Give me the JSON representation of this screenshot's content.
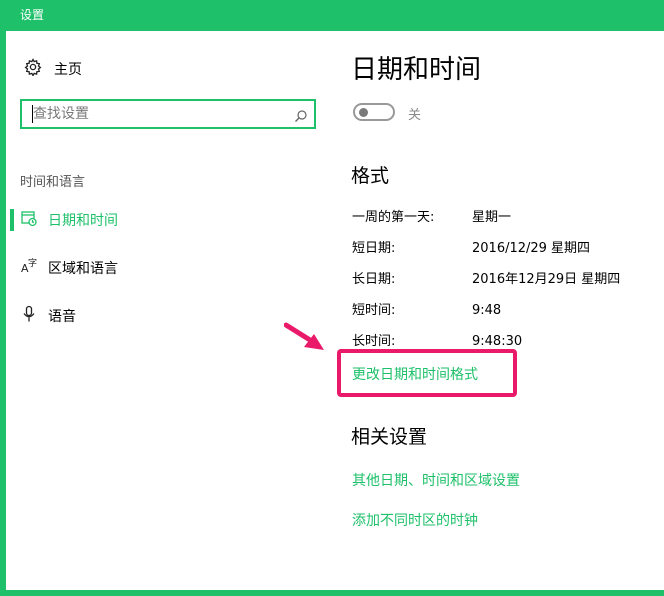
{
  "window": {
    "title": "设置"
  },
  "sidebar": {
    "home_label": "主页",
    "search": {
      "placeholder": "查找设置"
    },
    "section_label": "时间和语言",
    "items": [
      {
        "label": "日期和时间",
        "icon": "calendar-clock-icon",
        "active": true
      },
      {
        "label": "区域和语言",
        "icon": "language-icon",
        "active": false
      },
      {
        "label": "语音",
        "icon": "microphone-icon",
        "active": false
      }
    ]
  },
  "main": {
    "title": "日期和时间",
    "toggle": {
      "state_label": "关",
      "on": false
    },
    "format": {
      "heading": "格式",
      "rows": [
        {
          "label": "一周的第一天:",
          "value": "星期一"
        },
        {
          "label": "短日期:",
          "value": "2016/12/29 星期四"
        },
        {
          "label": "长日期:",
          "value": "2016年12月29日 星期四"
        },
        {
          "label": "短时间:",
          "value": "9:48"
        },
        {
          "label": "长时间:",
          "value": "9:48:30"
        }
      ],
      "change_link": "更改日期和时间格式"
    },
    "related": {
      "heading": "相关设置",
      "links": [
        "其他日期、时间和区域设置",
        "添加不同时区的时钟"
      ]
    }
  },
  "colors": {
    "accent": "#1ec16a",
    "annotation": "#ea1a6b"
  }
}
